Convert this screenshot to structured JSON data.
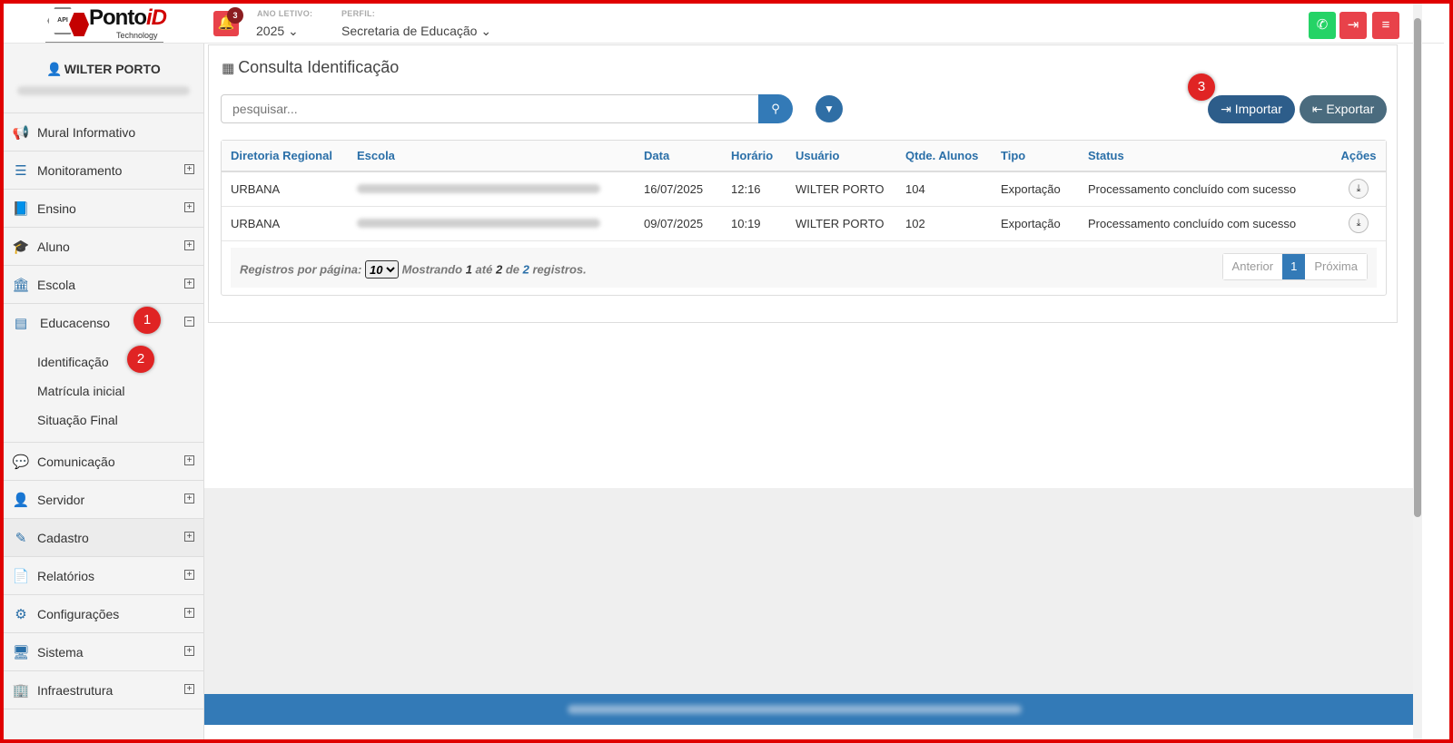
{
  "topbar": {
    "logo": {
      "hex": "API",
      "brand": "Ponto",
      "brand_accent": "iD",
      "sub": "Technology"
    },
    "notifications_count": "3",
    "ano_letivo_label": "ANO LETIVO:",
    "ano_letivo_value": "2025 ⌄",
    "perfil_label": "PERFIL:",
    "perfil_value": "Secretaria de Educação ⌄",
    "icons": {
      "whatsapp": "whatsapp-icon",
      "logout": "sign-out-icon",
      "menu": "hamburger-icon"
    },
    "colors": {
      "whatsapp": "#25d366",
      "logout": "#e8424a",
      "menu": "#e8424a"
    }
  },
  "sidebar": {
    "user_name": "WILTER PORTO",
    "items": [
      {
        "label": "Mural Informativo",
        "icon": "megaphone-icon"
      },
      {
        "label": "Monitoramento",
        "icon": "sliders-icon",
        "expander": "⊞"
      },
      {
        "label": "Ensino",
        "icon": "book-icon",
        "expander": "⊞"
      },
      {
        "label": "Aluno",
        "icon": "graduation-cap-icon",
        "expander": "⊞"
      },
      {
        "label": "Escola",
        "icon": "institution-icon",
        "expander": "⊞"
      },
      {
        "label": "Educacenso",
        "icon": "newspaper-icon",
        "expander": "⊟"
      },
      {
        "label": "Comunicação",
        "icon": "chat-bubble-icon",
        "expander": "⊞"
      },
      {
        "label": "Servidor",
        "icon": "user-icon",
        "expander": "⊞"
      },
      {
        "label": "Cadastro",
        "icon": "edit-icon",
        "expander": "⊞"
      },
      {
        "label": "Relatórios",
        "icon": "file-text-icon",
        "expander": "⊞"
      },
      {
        "label": "Configurações",
        "icon": "gear-icon",
        "expander": "⊞"
      },
      {
        "label": "Sistema",
        "icon": "monitor-icon",
        "expander": "⊞"
      },
      {
        "label": "Infraestrutura",
        "icon": "building-icon",
        "expander": "⊞"
      }
    ],
    "submenu": [
      "Identificação",
      "Matrícula inicial",
      "Situação Final"
    ]
  },
  "annotations": [
    "1",
    "2",
    "3"
  ],
  "main": {
    "title": "Consulta Identificação",
    "search_placeholder": "pesquisar...",
    "import_label": "Importar",
    "export_label": "Exportar",
    "table": {
      "headers": [
        "Diretoria Regional",
        "Escola",
        "Data",
        "Horário",
        "Usuário",
        "Qtde. Alunos",
        "Tipo",
        "Status",
        "Ações"
      ],
      "rows": [
        [
          "URBANA",
          "",
          "16/07/2025",
          "12:16",
          "WILTER PORTO",
          "104",
          "Exportação",
          "Processamento concluído com sucesso"
        ],
        [
          "URBANA",
          "",
          "09/07/2025",
          "10:19",
          "WILTER PORTO",
          "102",
          "Exportação",
          "Processamento concluído com sucesso"
        ]
      ]
    },
    "pagination": {
      "per_page_label": "Registros por página:",
      "per_page_value": "10",
      "showing": "Mostrando",
      "from": "1",
      "until": "até",
      "to": "2",
      "of": "de",
      "total": "2",
      "records": "registros.",
      "prev": "Anterior",
      "current": "1",
      "next": "Próxima"
    }
  }
}
